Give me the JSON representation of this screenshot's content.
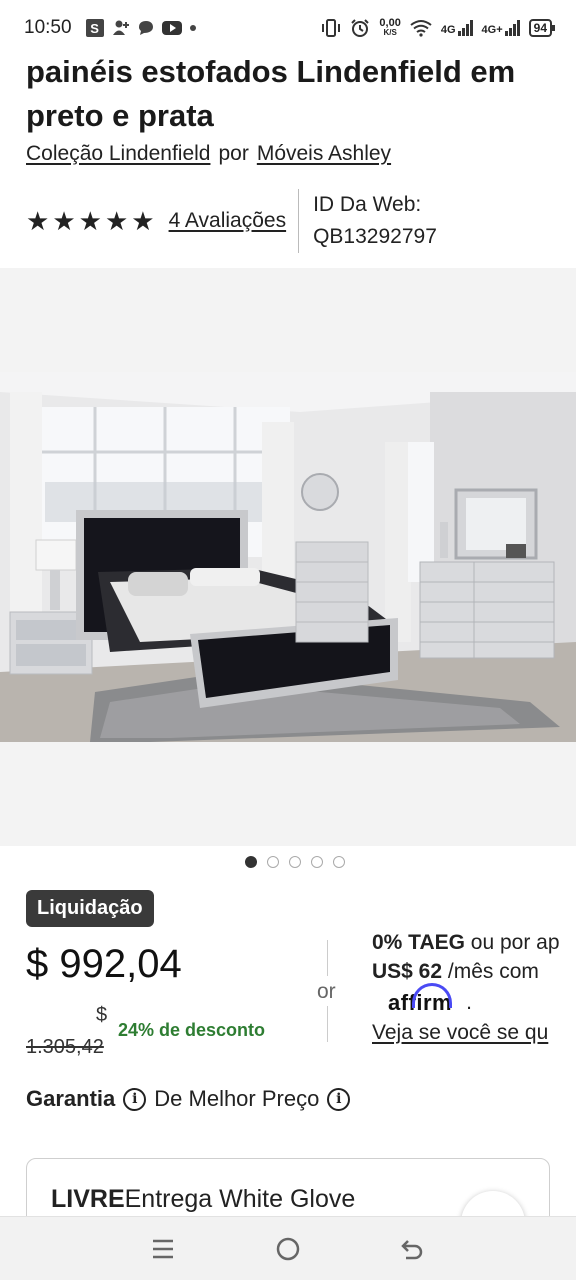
{
  "status_bar": {
    "time": "10:50",
    "icons": [
      "s-app-icon",
      "add-contact-icon",
      "chat-bubble-icon",
      "youtube-icon",
      "notification-dot-icon"
    ],
    "net_speed_value": "0,00",
    "net_speed_unit": "K/S",
    "sim1": "4G",
    "sim2": "4G+",
    "battery": "94"
  },
  "product": {
    "title": "painéis estofados Lindenfield em preto e prata",
    "collection_link": "Coleção Lindenfield",
    "by_text": "por",
    "brand_link": "Móveis Ashley",
    "rating_stars": 5,
    "reviews_link": "4 Avaliações",
    "web_id_label": "ID Da Web:",
    "web_id_value": "QB13292797"
  },
  "gallery": {
    "image_count": 5,
    "active_index": 0
  },
  "pricing": {
    "badge": "Liquidação",
    "price": "$ 992,04",
    "was_currency": "$",
    "was_price": "1.305,42",
    "discount": "24% de desconto",
    "or_text": "or",
    "financing_bold_1": "0% TAEG",
    "financing_text_1": " ou por ap",
    "financing_bold_2": "US$ 62",
    "financing_text_2": " /mês com",
    "affirm_logo": "affirm",
    "affirm_period": ".",
    "check_link": "Veja se você se qu"
  },
  "guarantee": {
    "bold": "Garantia",
    "text": "De Melhor Preço"
  },
  "delivery": {
    "bold": "LIVRE",
    "text": "Entrega White Glove"
  },
  "nav": {
    "buttons": [
      "menu-icon",
      "home-icon",
      "back-icon"
    ]
  }
}
